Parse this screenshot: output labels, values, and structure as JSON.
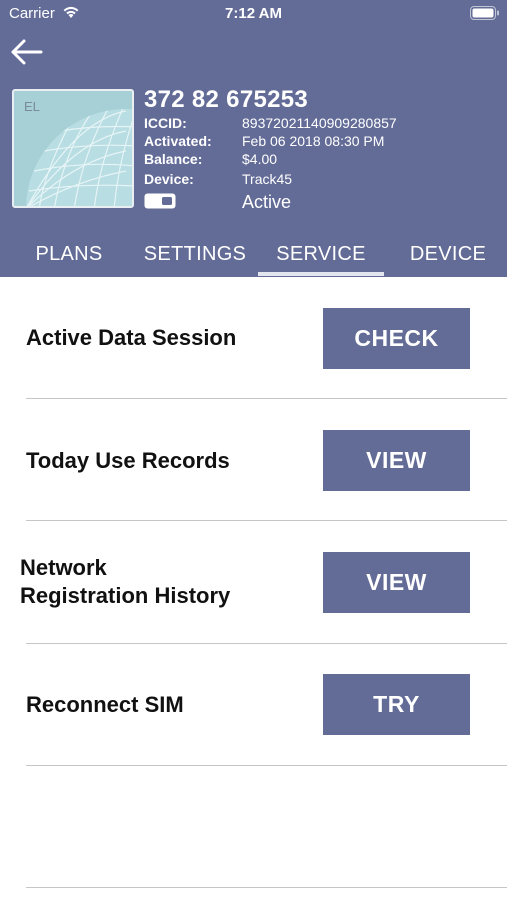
{
  "status_bar": {
    "carrier": "Carrier",
    "time": "7:12 AM"
  },
  "colors": {
    "header_bg": "#636c97",
    "button_bg": "#636c97",
    "text_on_dark": "#ffffff",
    "divider": "#c6c6c6"
  },
  "sim": {
    "card_label": "EL",
    "number": "372 82 675253",
    "details": [
      {
        "key": "ICCID:",
        "value": "89372021140909280857"
      },
      {
        "key": "Activated:",
        "value": "Feb 06 2018 08:30 PM"
      },
      {
        "key": "Balance:",
        "value": "$4.00"
      },
      {
        "key": "Device:",
        "value": "Track45"
      }
    ],
    "status": "Active"
  },
  "tabs": [
    {
      "label": "PLANS",
      "selected": false
    },
    {
      "label": "SETTINGS",
      "selected": false
    },
    {
      "label": "SERVICE",
      "selected": true
    },
    {
      "label": "DEVICE",
      "selected": false
    }
  ],
  "service_rows": [
    {
      "label": "Active Data Session",
      "button": "CHECK"
    },
    {
      "label_line1": "Today Use Records",
      "button": "VIEW"
    },
    {
      "label_line1": "Network",
      "label_line2": "Registration History",
      "button": "VIEW"
    },
    {
      "label": "Reconnect SIM",
      "button": "TRY"
    }
  ]
}
